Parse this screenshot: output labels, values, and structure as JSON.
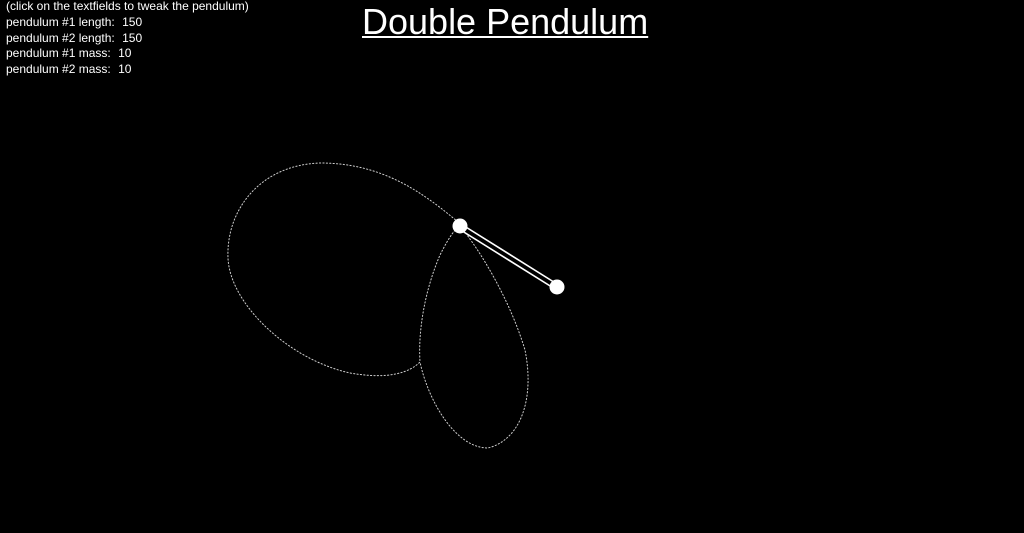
{
  "hint": "(click on the textfields to tweak the pendulum)",
  "title": "Double Pendulum",
  "params": [
    {
      "label": "pendulum #1 length:",
      "value": "150"
    },
    {
      "label": "pendulum #2 length:",
      "value": "150"
    },
    {
      "label": "pendulum #1 mass:",
      "value": "10"
    },
    {
      "label": "pendulum #2 mass:",
      "value": "10"
    }
  ],
  "colors": {
    "background": "#000000",
    "foreground": "#ffffff",
    "trace": "#cfcfcf"
  }
}
